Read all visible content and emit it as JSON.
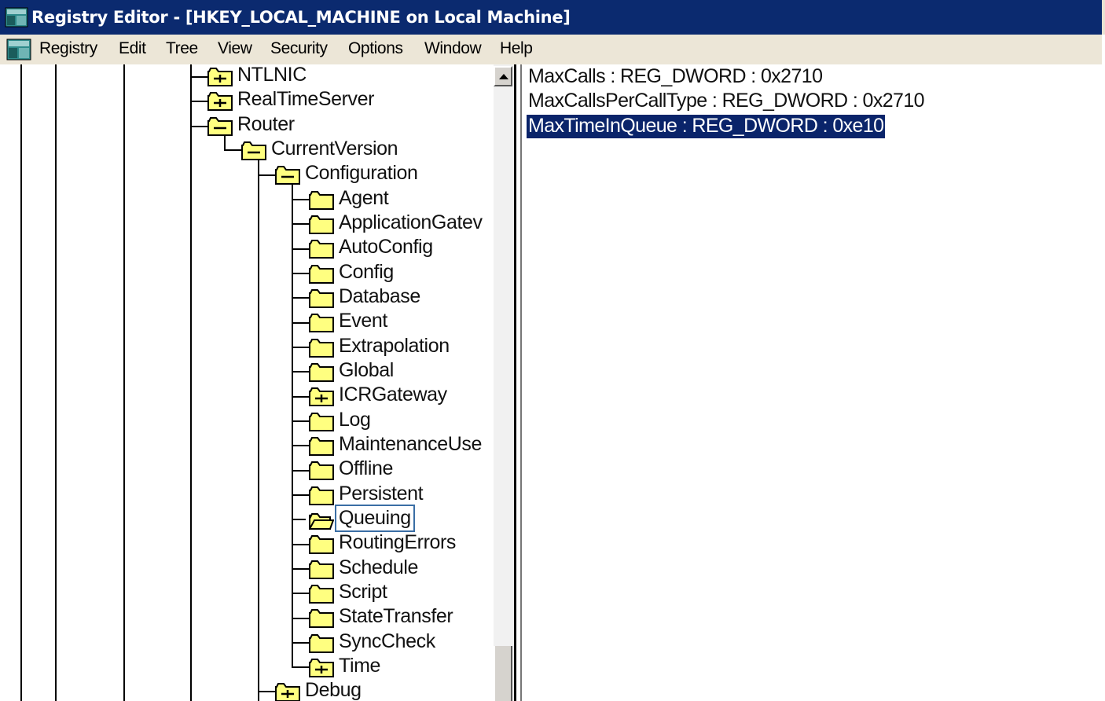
{
  "window": {
    "title": "Registry Editor - [HKEY_LOCAL_MACHINE on Local Machine]"
  },
  "menubar": {
    "items": [
      "Registry",
      "Edit",
      "Tree",
      "View",
      "Security",
      "Options",
      "Window",
      "Help"
    ]
  },
  "tree": {
    "nodes": [
      {
        "label": "NTLNIC",
        "icon": "folder-plus-icon",
        "state": "collapsed"
      },
      {
        "label": "RealTimeServer",
        "icon": "folder-plus-icon",
        "state": "collapsed"
      },
      {
        "label": "Router",
        "icon": "folder-minus-icon",
        "state": "expanded"
      },
      {
        "label": "CurrentVersion",
        "icon": "folder-minus-icon",
        "state": "expanded"
      },
      {
        "label": "Configuration",
        "icon": "folder-minus-icon",
        "state": "expanded"
      },
      {
        "label": "Agent",
        "icon": "folder-icon",
        "state": "leaf"
      },
      {
        "label": "ApplicationGatev",
        "icon": "folder-icon",
        "state": "leaf"
      },
      {
        "label": "AutoConfig",
        "icon": "folder-icon",
        "state": "leaf"
      },
      {
        "label": "Config",
        "icon": "folder-icon",
        "state": "leaf"
      },
      {
        "label": "Database",
        "icon": "folder-icon",
        "state": "leaf"
      },
      {
        "label": "Event",
        "icon": "folder-icon",
        "state": "leaf"
      },
      {
        "label": "Extrapolation",
        "icon": "folder-icon",
        "state": "leaf"
      },
      {
        "label": "Global",
        "icon": "folder-icon",
        "state": "leaf"
      },
      {
        "label": "ICRGateway",
        "icon": "folder-plus-icon",
        "state": "collapsed"
      },
      {
        "label": "Log",
        "icon": "folder-icon",
        "state": "leaf"
      },
      {
        "label": "MaintenanceUse",
        "icon": "folder-icon",
        "state": "leaf"
      },
      {
        "label": "Offline",
        "icon": "folder-icon",
        "state": "leaf"
      },
      {
        "label": "Persistent",
        "icon": "folder-icon",
        "state": "leaf"
      },
      {
        "label": "Queuing",
        "icon": "folder-open-icon",
        "state": "selected"
      },
      {
        "label": "RoutingErrors",
        "icon": "folder-icon",
        "state": "leaf"
      },
      {
        "label": "Schedule",
        "icon": "folder-icon",
        "state": "leaf"
      },
      {
        "label": "Script",
        "icon": "folder-icon",
        "state": "leaf"
      },
      {
        "label": "StateTransfer",
        "icon": "folder-icon",
        "state": "leaf"
      },
      {
        "label": "SyncCheck",
        "icon": "folder-icon",
        "state": "leaf"
      },
      {
        "label": "Time",
        "icon": "folder-plus-icon",
        "state": "collapsed"
      },
      {
        "label": "Debug",
        "icon": "folder-plus-icon",
        "state": "collapsed"
      }
    ]
  },
  "values": {
    "rows": [
      {
        "text": "MaxCalls : REG_DWORD : 0x2710",
        "selected": false
      },
      {
        "text": "MaxCallsPerCallType : REG_DWORD : 0x2710",
        "selected": false
      },
      {
        "text": "MaxTimeInQueue : REG_DWORD : 0xe10",
        "selected": true
      }
    ]
  },
  "colors": {
    "titlebar": "#0b2a6f",
    "menubar": "#ece6d7",
    "selection": "#0a246a",
    "folder": "#ffff80"
  }
}
